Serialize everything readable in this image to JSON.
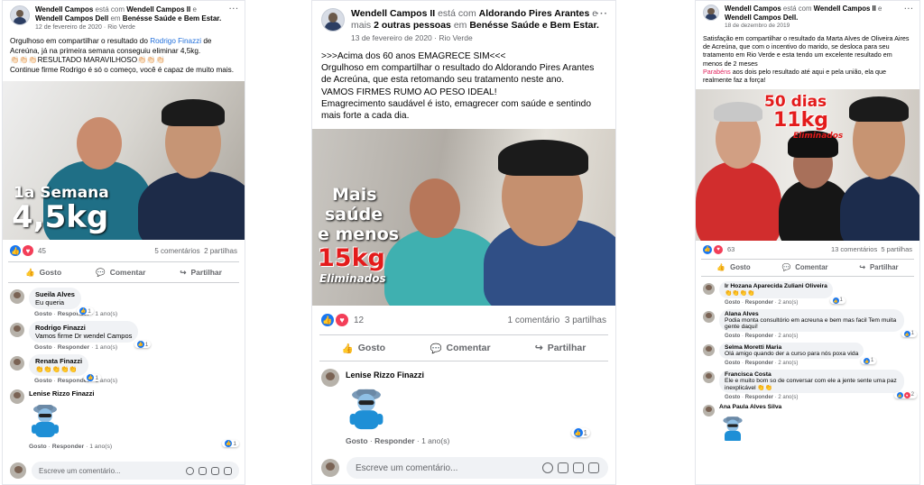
{
  "colors": {
    "like": "#1877f2",
    "love": "#f33e58",
    "link": "#216fdb",
    "highlight": "#e0245e",
    "muted": "#65676b"
  },
  "post1": {
    "author": "Wendell Campos",
    "with_word": "está com",
    "with1": "Wendell Campos II",
    "conj": "e",
    "with2": "Wendell Campos Dell",
    "in_word": "em",
    "group": "Benésse Saúde e Bem Estar",
    "group_suffix": ".",
    "date": "12 de fevereiro de 2020",
    "place": "Rio Verde",
    "text_a": "Orgulhoso em compartilhar o resultado do",
    "text_tag": "Rodrigo Finazzi",
    "text_b": "de Acreúna, já na primeira semana conseguiu eliminar 4,5kg.",
    "line2": "👏🏻👏🏻👏🏻RESULTADO MARAVILHOSO👏🏻👏🏻👏🏻",
    "line3": "Continue firme Rodrigo é só o começo, você é capaz de muito mais.",
    "overlay1": "1a Semana",
    "overlay2": "4,5kg",
    "reactions": "45",
    "comments_count": "5 comentários",
    "shares": "2 partilhas",
    "act_like": "Gosto",
    "act_comment": "Comentar",
    "act_share": "Partilhar",
    "comments": [
      {
        "name": "Sueila Alves",
        "text": "Eu queria",
        "like": "Gosto",
        "reply": "Responder",
        "time": "1 ano(s)",
        "rc": "1"
      },
      {
        "name": "Rodrigo Finazzi",
        "text": "Vamos firme Dr wendel Campos",
        "like": "Gosto",
        "reply": "Responder",
        "time": "1 ano(s)",
        "rc": "1"
      },
      {
        "name": "Renata Finazzi",
        "text": "👏👏👏👏👏",
        "like": "Gosto",
        "reply": "Responder",
        "time": "1 ano(s)",
        "rc": "1"
      },
      {
        "name": "Lenise Rizzo Finazzi",
        "text": "",
        "like": "Gosto",
        "reply": "Responder",
        "time": "1 ano(s)",
        "rc": "1"
      }
    ],
    "composer_placeholder": "Escreve um comentário..."
  },
  "post2": {
    "author": "Wendell Campos II",
    "with_word": "está com",
    "with1": "Aldorando Pires Arantes",
    "conj": "e mais",
    "with2": "2 outras pessoas",
    "in_word": "em",
    "group": "Benésse Saúde e Bem Estar",
    "group_suffix": ".",
    "date": "13 de fevereiro de 2020",
    "place": "Rio Verde",
    "line1": ">>>Acima dos 60 anos EMAGRECE SIM<<<",
    "line2": "Orgulhoso em compartilhar o resultado do Aldorando Pires Arantes de Acreúna, que esta retomando seu tratamento neste ano.",
    "line3": "VAMOS FIRMES RUMO AO PESO IDEAL!",
    "line4": "Emagrecimento saudável é isto, emagrecer com saúde e sentindo mais forte a cada dia.",
    "overlay1": "Mais",
    "overlay2": "saúde",
    "overlay3": "e menos",
    "overlay4": "15kg",
    "overlay5": "Eliminados",
    "reactions": "12",
    "comments_count": "1 comentário",
    "shares": "3 partilhas",
    "act_like": "Gosto",
    "act_comment": "Comentar",
    "act_share": "Partilhar",
    "comment": {
      "name": "Lenise Rizzo Finazzi",
      "like": "Gosto",
      "reply": "Responder",
      "time": "1 ano(s)",
      "rc": "1"
    },
    "composer_placeholder": "Escreve um comentário..."
  },
  "post3": {
    "author": "Wendell Campos",
    "with_word": "está com",
    "with1": "Wendell Campos II",
    "conj": "e",
    "with2": "Wendell Campos Dell",
    "group_suffix": ".",
    "date": "18 de dezembro de 2019",
    "text1": "Satisfação em compartilhar o resultado da Marta Alves de Oliveira Aires de Acreúna, que com o incentivo do marido, se deslocа para seu tratamento em Rio Verde e esta tendo um excelente resultado em menos de 2 meses",
    "text2_hl": "Parabéns",
    "text2": "aos dois pelo resultado até aqui e pela união, ela que realmente faz a força!",
    "overlay1": "50 dias",
    "overlay2": "11kg",
    "overlay3": "Eliminados",
    "reactions": "63",
    "comments_count": "13 comentários",
    "shares": "5 partilhas",
    "act_like": "Gosto",
    "act_comment": "Comentar",
    "act_share": "Partilhar",
    "comments": [
      {
        "name": "Ir Hozana Aparecida Zuliani Oliveira",
        "text": "👏👏👏👏",
        "like": "Gosto",
        "reply": "Responder",
        "time": "2 ano(s)",
        "rc": "1"
      },
      {
        "name": "Alana Alves",
        "text": "Podia monta consultório em acreuna e bem mas facil Tem muita gente daqui!",
        "like": "Gosto",
        "reply": "Responder",
        "time": "2 ano(s)",
        "rc": "1"
      },
      {
        "name": "Selma Moretti Maria",
        "text": "Olá amigo quando der a curso para nós poxa vida",
        "like": "Gosto",
        "reply": "Responder",
        "time": "2 ano(s)",
        "rc": "1"
      },
      {
        "name": "Francisca Costa",
        "text": "Ele e muito bom so de conversar com ele a jente sente uma paz inexplicável 👏👏",
        "like": "Gosto",
        "reply": "Responder",
        "time": "2 ano(s)",
        "rc": "2"
      },
      {
        "name": "Ana Paula Alves Silva",
        "text": ""
      }
    ]
  }
}
